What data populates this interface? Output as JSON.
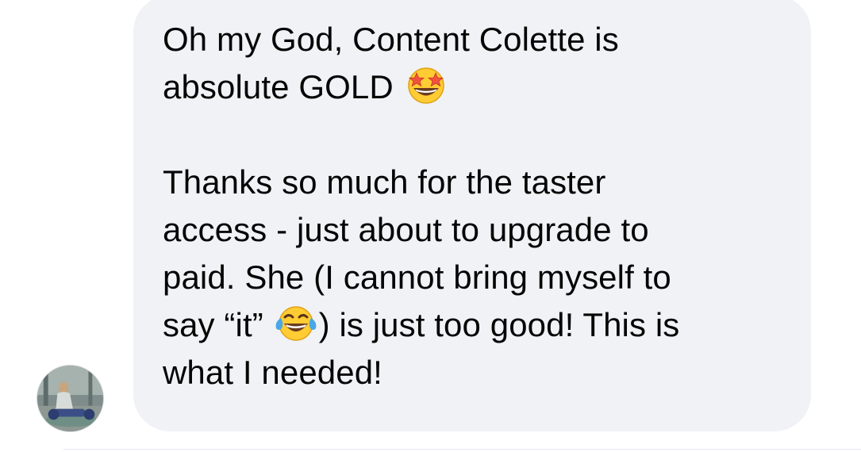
{
  "message": {
    "para1": {
      "line1": "Oh my God, Content Colette is",
      "line2_text": "absolute GOLD",
      "line2_emoji": "star-struck-emoji"
    },
    "para2": {
      "line1": "Thanks so much for the taster",
      "line2": "access - just about to upgrade to",
      "line3": "paid. She (I cannot bring myself to",
      "line4_before": "say “it”",
      "line4_emoji": "tears-of-joy-emoji",
      "line4_after": ") is just too good! This is",
      "line5": "what I needed!"
    }
  },
  "colors": {
    "bubble_background": "#f1f2f5",
    "text": "#050505",
    "emoji_yellow": "#ffcc33"
  },
  "icons": {
    "avatar": "user-avatar-photo"
  }
}
